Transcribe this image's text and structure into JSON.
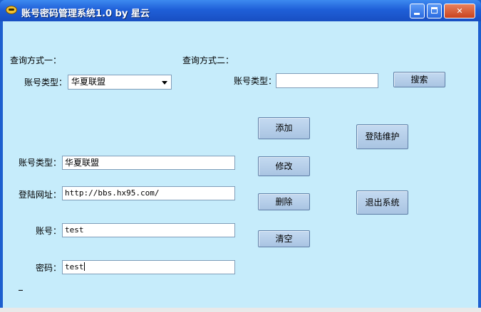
{
  "window": {
    "title": "账号密码管理系统1.0 by 星云"
  },
  "query1": {
    "heading": "查询方式一：",
    "type_label": "账号类型：",
    "type_selected": "华夏联盟"
  },
  "query2": {
    "heading": "查询方式二：",
    "type_label": "账号类型：",
    "type_value": "",
    "search_label": "搜索"
  },
  "form": {
    "type_label": "账号类型：",
    "type_value": "华夏联盟",
    "url_label": "登陆网址：",
    "url_value": "http://bbs.hx95.com/",
    "account_label": "账号：",
    "account_value": "test",
    "password_label": "密码：",
    "password_value": "test"
  },
  "actions": {
    "add_label": "添加",
    "edit_label": "修改",
    "delete_label": "删除",
    "clear_label": "清空",
    "maintain_label": "登陆维护",
    "exit_label": "退出系统"
  }
}
